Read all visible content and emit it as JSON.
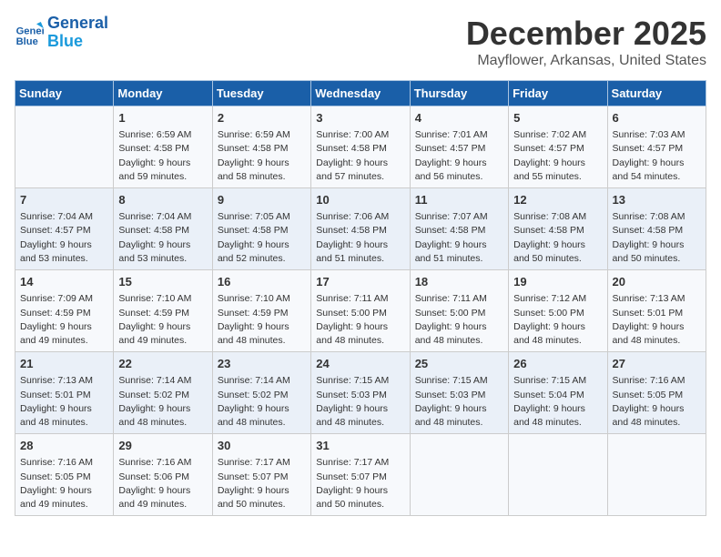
{
  "header": {
    "logo_line1": "General",
    "logo_line2": "Blue",
    "month_title": "December 2025",
    "location": "Mayflower, Arkansas, United States"
  },
  "weekdays": [
    "Sunday",
    "Monday",
    "Tuesday",
    "Wednesday",
    "Thursday",
    "Friday",
    "Saturday"
  ],
  "weeks": [
    [
      {
        "day": "",
        "info": ""
      },
      {
        "day": "1",
        "info": "Sunrise: 6:59 AM\nSunset: 4:58 PM\nDaylight: 9 hours\nand 59 minutes."
      },
      {
        "day": "2",
        "info": "Sunrise: 6:59 AM\nSunset: 4:58 PM\nDaylight: 9 hours\nand 58 minutes."
      },
      {
        "day": "3",
        "info": "Sunrise: 7:00 AM\nSunset: 4:58 PM\nDaylight: 9 hours\nand 57 minutes."
      },
      {
        "day": "4",
        "info": "Sunrise: 7:01 AM\nSunset: 4:57 PM\nDaylight: 9 hours\nand 56 minutes."
      },
      {
        "day": "5",
        "info": "Sunrise: 7:02 AM\nSunset: 4:57 PM\nDaylight: 9 hours\nand 55 minutes."
      },
      {
        "day": "6",
        "info": "Sunrise: 7:03 AM\nSunset: 4:57 PM\nDaylight: 9 hours\nand 54 minutes."
      }
    ],
    [
      {
        "day": "7",
        "info": "Sunrise: 7:04 AM\nSunset: 4:57 PM\nDaylight: 9 hours\nand 53 minutes."
      },
      {
        "day": "8",
        "info": "Sunrise: 7:04 AM\nSunset: 4:58 PM\nDaylight: 9 hours\nand 53 minutes."
      },
      {
        "day": "9",
        "info": "Sunrise: 7:05 AM\nSunset: 4:58 PM\nDaylight: 9 hours\nand 52 minutes."
      },
      {
        "day": "10",
        "info": "Sunrise: 7:06 AM\nSunset: 4:58 PM\nDaylight: 9 hours\nand 51 minutes."
      },
      {
        "day": "11",
        "info": "Sunrise: 7:07 AM\nSunset: 4:58 PM\nDaylight: 9 hours\nand 51 minutes."
      },
      {
        "day": "12",
        "info": "Sunrise: 7:08 AM\nSunset: 4:58 PM\nDaylight: 9 hours\nand 50 minutes."
      },
      {
        "day": "13",
        "info": "Sunrise: 7:08 AM\nSunset: 4:58 PM\nDaylight: 9 hours\nand 50 minutes."
      }
    ],
    [
      {
        "day": "14",
        "info": "Sunrise: 7:09 AM\nSunset: 4:59 PM\nDaylight: 9 hours\nand 49 minutes."
      },
      {
        "day": "15",
        "info": "Sunrise: 7:10 AM\nSunset: 4:59 PM\nDaylight: 9 hours\nand 49 minutes."
      },
      {
        "day": "16",
        "info": "Sunrise: 7:10 AM\nSunset: 4:59 PM\nDaylight: 9 hours\nand 48 minutes."
      },
      {
        "day": "17",
        "info": "Sunrise: 7:11 AM\nSunset: 5:00 PM\nDaylight: 9 hours\nand 48 minutes."
      },
      {
        "day": "18",
        "info": "Sunrise: 7:11 AM\nSunset: 5:00 PM\nDaylight: 9 hours\nand 48 minutes."
      },
      {
        "day": "19",
        "info": "Sunrise: 7:12 AM\nSunset: 5:00 PM\nDaylight: 9 hours\nand 48 minutes."
      },
      {
        "day": "20",
        "info": "Sunrise: 7:13 AM\nSunset: 5:01 PM\nDaylight: 9 hours\nand 48 minutes."
      }
    ],
    [
      {
        "day": "21",
        "info": "Sunrise: 7:13 AM\nSunset: 5:01 PM\nDaylight: 9 hours\nand 48 minutes."
      },
      {
        "day": "22",
        "info": "Sunrise: 7:14 AM\nSunset: 5:02 PM\nDaylight: 9 hours\nand 48 minutes."
      },
      {
        "day": "23",
        "info": "Sunrise: 7:14 AM\nSunset: 5:02 PM\nDaylight: 9 hours\nand 48 minutes."
      },
      {
        "day": "24",
        "info": "Sunrise: 7:15 AM\nSunset: 5:03 PM\nDaylight: 9 hours\nand 48 minutes."
      },
      {
        "day": "25",
        "info": "Sunrise: 7:15 AM\nSunset: 5:03 PM\nDaylight: 9 hours\nand 48 minutes."
      },
      {
        "day": "26",
        "info": "Sunrise: 7:15 AM\nSunset: 5:04 PM\nDaylight: 9 hours\nand 48 minutes."
      },
      {
        "day": "27",
        "info": "Sunrise: 7:16 AM\nSunset: 5:05 PM\nDaylight: 9 hours\nand 48 minutes."
      }
    ],
    [
      {
        "day": "28",
        "info": "Sunrise: 7:16 AM\nSunset: 5:05 PM\nDaylight: 9 hours\nand 49 minutes."
      },
      {
        "day": "29",
        "info": "Sunrise: 7:16 AM\nSunset: 5:06 PM\nDaylight: 9 hours\nand 49 minutes."
      },
      {
        "day": "30",
        "info": "Sunrise: 7:17 AM\nSunset: 5:07 PM\nDaylight: 9 hours\nand 50 minutes."
      },
      {
        "day": "31",
        "info": "Sunrise: 7:17 AM\nSunset: 5:07 PM\nDaylight: 9 hours\nand 50 minutes."
      },
      {
        "day": "",
        "info": ""
      },
      {
        "day": "",
        "info": ""
      },
      {
        "day": "",
        "info": ""
      }
    ]
  ]
}
